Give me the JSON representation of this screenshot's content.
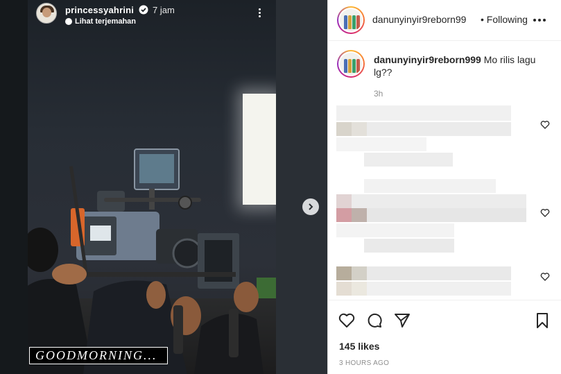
{
  "story": {
    "username": "princessyahrini",
    "time": "7 jam",
    "translate_label": "Lihat terjemahan",
    "caption": "GOODMORNING..."
  },
  "post": {
    "username": "danunyinyir9reborn99",
    "separator": "•",
    "follow_status": "Following"
  },
  "comment": {
    "username": "danunyinyir9reborn999",
    "text": "Mo rilis lagu lg??",
    "age": "3h"
  },
  "actions": {
    "likes": "145 likes",
    "post_age": "3 HOURS AGO"
  },
  "icons": {
    "verified": "verified-badge-icon",
    "translate": "translate-icon",
    "story_menu": "more-vertical-icon",
    "next": "chevron-right-icon",
    "post_menu": "more-horizontal-icon",
    "like": "heart-icon",
    "comment": "comment-icon",
    "share": "share-icon",
    "save": "bookmark-icon"
  },
  "colors": {
    "accent_ring_start": "#fdbb34",
    "accent_ring_mid": "#d62976",
    "text_primary": "#262626",
    "text_secondary": "#8e8e8e"
  }
}
